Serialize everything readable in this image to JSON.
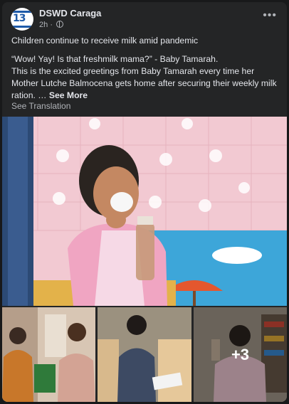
{
  "post": {
    "page_name": "DSWD Caraga",
    "time": "2h",
    "title": "Children continue to receive milk amid pandemic",
    "body_line1": "“Wow! Yay! Is that freshmilk mama?” -  Baby Tamarah.",
    "body_rest": "This is the excited greetings from Baby Tamarah every time her Mother Lutche Balmocena gets home after securing their weekly milk ration. …",
    "see_more": "See More",
    "see_translation": "See Translation",
    "more_photos": "+3",
    "avatar_text": "13"
  },
  "icons": {
    "privacy": "globe-icon",
    "options": "more-horizontal-icon"
  },
  "colors": {
    "background": "#18191a",
    "card": "#242526",
    "text_primary": "#e4e6eb",
    "text_secondary": "#b0b3b8"
  }
}
